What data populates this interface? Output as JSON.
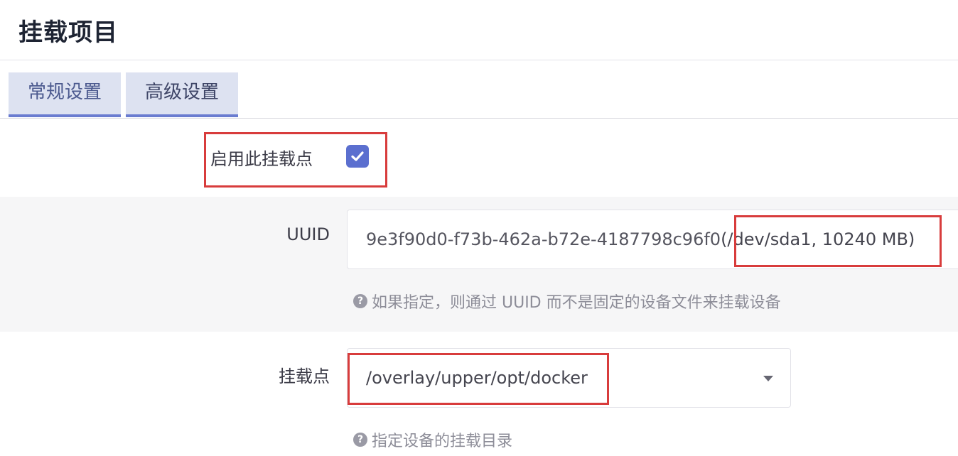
{
  "page": {
    "title": "挂载项目"
  },
  "tabs": [
    {
      "label": "常规设置",
      "active": true
    },
    {
      "label": "高级设置",
      "active": false
    }
  ],
  "enable": {
    "label": "启用此挂载点",
    "checked": true
  },
  "uuid": {
    "label": "UUID",
    "value": "9e3f90d0-f73b-462a-b72e-4187798c96f0",
    "device": "(/dev/sda1, 10240 MB)",
    "hint": "如果指定，则通过 UUID 而不是固定的设备文件来挂载设备"
  },
  "mount_point": {
    "label": "挂载点",
    "value": "/overlay/upper/opt/docker",
    "hint": "指定设备的挂载目录"
  },
  "icons": {
    "help": "question-circle-icon",
    "check": "check-icon",
    "dropdown": "chevron-down-icon"
  },
  "colors": {
    "accent": "#5b6fcf",
    "tab_bg": "#dde2f1",
    "highlight": "#d83c3c"
  }
}
